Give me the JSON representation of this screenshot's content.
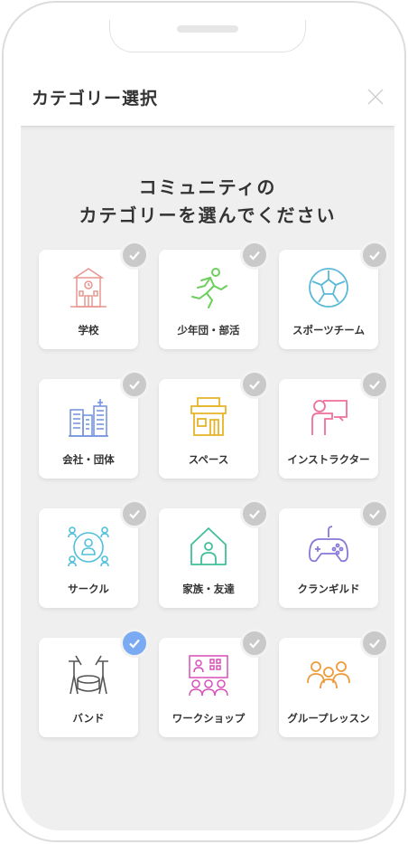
{
  "header": {
    "title": "カテゴリー選択"
  },
  "heading": {
    "line1": "コミュニティの",
    "line2": "カテゴリーを選んでください"
  },
  "colors": {
    "selected_check": "#7aaaf2",
    "unselected_check": "#c9c9c9"
  },
  "categories": [
    {
      "label": "学校",
      "icon": "school-icon",
      "selected": false
    },
    {
      "label": "少年団・部活",
      "icon": "running-person-icon",
      "selected": false
    },
    {
      "label": "スポーツチーム",
      "icon": "soccer-ball-icon",
      "selected": false
    },
    {
      "label": "会社・団体",
      "icon": "office-buildings-icon",
      "selected": false
    },
    {
      "label": "スペース",
      "icon": "shop-icon",
      "selected": false
    },
    {
      "label": "インストラクター",
      "icon": "instructor-board-icon",
      "selected": false
    },
    {
      "label": "サークル",
      "icon": "people-circle-icon",
      "selected": false
    },
    {
      "label": "家族・友達",
      "icon": "house-icon",
      "selected": false
    },
    {
      "label": "クランギルド",
      "icon": "gamepad-icon",
      "selected": false
    },
    {
      "label": "バンド",
      "icon": "drum-set-icon",
      "selected": true
    },
    {
      "label": "ワークショップ",
      "icon": "workshop-icon",
      "selected": false
    },
    {
      "label": "グループレッスン",
      "icon": "group-people-icon",
      "selected": false
    }
  ]
}
